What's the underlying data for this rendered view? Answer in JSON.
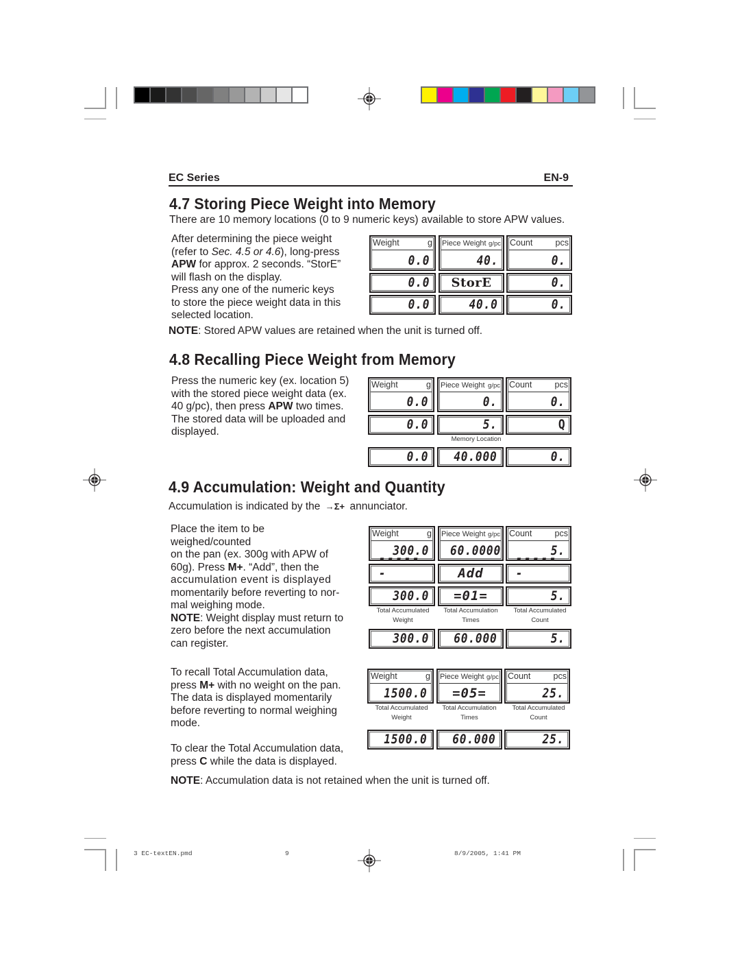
{
  "print_marks": {
    "gray_swatches": [
      "#000000",
      "#1a1a1a",
      "#333333",
      "#4d4d4d",
      "#666666",
      "#808080",
      "#999999",
      "#b3b3b3",
      "#cccccc",
      "#e6e6e6",
      "#ffffff"
    ],
    "color_swatches": [
      "#fff200",
      "#ec008c",
      "#00aeef",
      "#2e3192",
      "#00a651",
      "#ed1c24",
      "#231f20",
      "#fff799",
      "#f49ac1",
      "#6dcff6",
      "#939598"
    ]
  },
  "header": {
    "left": "EC Series",
    "right": "EN-9"
  },
  "s47": {
    "title": "4.7 Storing Piece Weight into Memory",
    "intro": "There are 10 memory locations (0 to 9 numeric keys) available to store APW values.",
    "body_1": "After determining the piece weight",
    "body_2a": "(refer to ",
    "body_2b": "Sec. 4.5 or 4.6",
    "body_2c": "), long-press",
    "body_3a": "APW",
    "body_3b": " for approx. 2 seconds.  “StorE”",
    "body_4": "will flash on the display.",
    "body_5": "Press any one of the numeric keys",
    "body_6": "to store the piece weight data in this",
    "body_7": "selected location.",
    "note_label": "NOTE",
    "note_text": ": Stored APW values are retained when the unit is turned off.",
    "rows": [
      [
        "0.0",
        "40.",
        "0."
      ],
      [
        "0.0",
        "StorE",
        "0."
      ],
      [
        "0.0",
        "40.0",
        "0."
      ]
    ]
  },
  "labels": {
    "weight": "Weight",
    "weight_unit": "g",
    "piece": "Piece Weight",
    "piece_unit": "g/pc",
    "count": "Count",
    "count_unit": "pcs",
    "memory_location": "Memory  Location",
    "taw_1": "Total  Accumulated",
    "taw_2": "Weight",
    "tat_1": "Total  Accumulation",
    "tat_2": "Times",
    "tac_1": "Total  Accumulated",
    "tac_2": "Count"
  },
  "s48": {
    "title": "4.8 Recalling Piece Weight from Memory",
    "body_1": "Press the numeric key (ex. location 5)",
    "body_2": "with the stored piece weight data (ex.",
    "body_3a": "40 g/pc), then press ",
    "body_3b": "APW",
    "body_3c": " two times.",
    "body_4": "The stored data will be uploaded and",
    "body_5": "displayed.",
    "rows": [
      [
        "0.0",
        "0.",
        "0."
      ],
      [
        "0.0",
        "5.",
        "Q"
      ],
      [
        "0.0",
        "40.000",
        "0."
      ]
    ]
  },
  "s49": {
    "title": "4.9 Accumulation: Weight and Quantity",
    "intro_a": "Accumulation is indicated by the",
    "annunciator": "→Σ+",
    "intro_b": "annunciator.",
    "p1_1": "Place the item to be weighed/counted",
    "p1_2": "on the pan (ex. 300g with APW of",
    "p1_3a": "60g).  Press ",
    "p1_3b": "M+",
    "p1_3c": ".  “Add”, then the",
    "p1_4": "accumulation event is displayed",
    "p1_5": "momentarily before reverting to nor-",
    "p1_6": "mal weighing mode.",
    "p1_7a": "NOTE",
    "p1_7b": ": Weight display must return to",
    "p1_8": "zero before the next accumulation",
    "p1_9": "can register.",
    "p2_1": "To recall Total Accumulation data,",
    "p2_2a": "press ",
    "p2_2b": "M+",
    "p2_2c": " with no weight on the pan.",
    "p2_3": "The data is displayed momentarily",
    "p2_4": "before reverting to normal weighing",
    "p2_5": "mode.",
    "p3_1": "To clear the Total Accumulation data,",
    "p3_2a": "press ",
    "p3_2b": "C",
    "p3_2c": " while the data is displayed.",
    "note_label": "NOTE",
    "note_text": ": Accumulation data is not retained when the unit is turned off.",
    "rows_a": [
      [
        "300.0",
        "60.0000",
        "5."
      ],
      [
        "------",
        "Add",
        "------"
      ],
      [
        "300.0",
        "=01=",
        "5."
      ],
      [
        "300.0",
        "60.000",
        "5."
      ]
    ],
    "rows_b": [
      [
        "1500.0",
        "=05=",
        "25."
      ],
      [
        "1500.0",
        "60.000",
        "25."
      ]
    ]
  },
  "footer": {
    "file": "3 EC-textEN.pmd",
    "page": "9",
    "datetime": "8/9/2005, 1:41 PM"
  }
}
